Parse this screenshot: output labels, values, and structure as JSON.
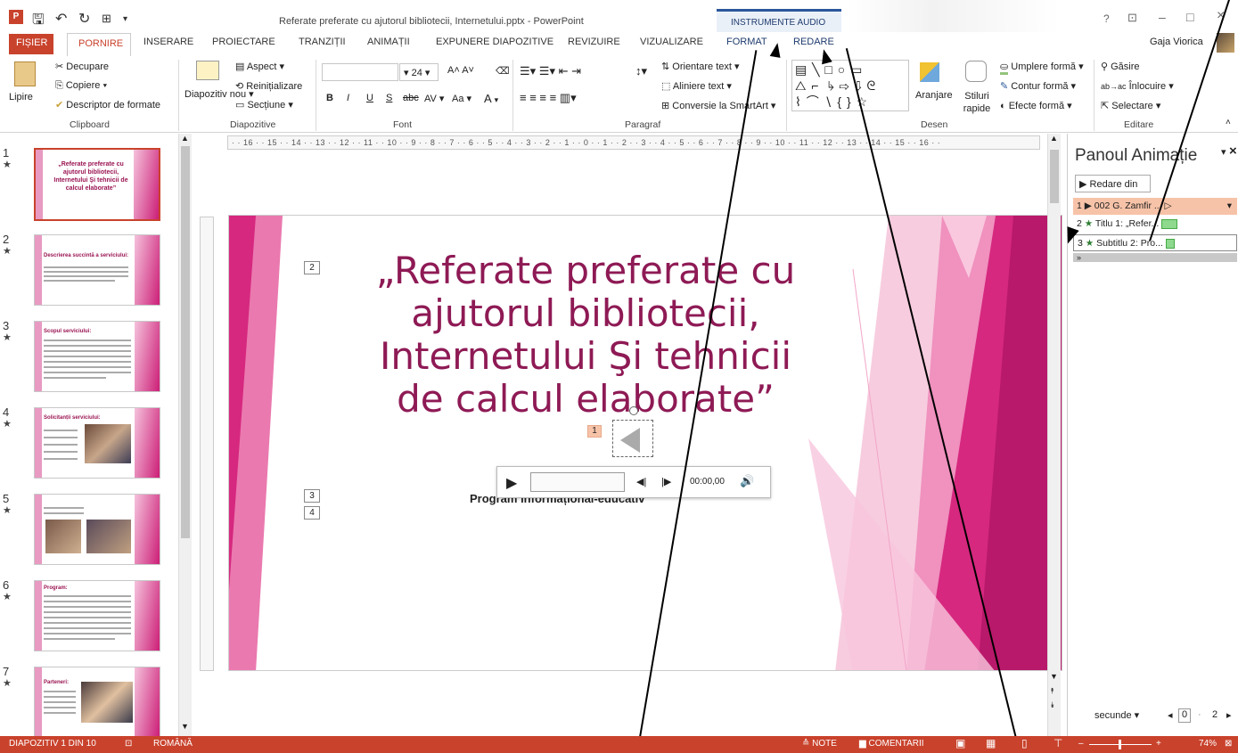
{
  "window": {
    "title": "Referate preferate cu ajutorul bibliotecii, Internetului.pptx - PowerPoint",
    "help": "?",
    "restore_ribbon": "⊡",
    "minimize": "–",
    "maximize": "□",
    "close": "×"
  },
  "context_tab": {
    "label": "INSTRUMENTE AUDIO"
  },
  "tabs": [
    "FIȘIER",
    "PORNIRE",
    "INSERARE",
    "PROIECTARE",
    "TRANZIȚII",
    "ANIMAȚII",
    "EXPUNERE DIAPOZITIVE",
    "REVIZUIRE",
    "VIZUALIZARE",
    "FORMAT",
    "REDARE"
  ],
  "user": {
    "name": "Gaja Viorica"
  },
  "ribbon": {
    "clipboard": {
      "paste": "Lipire",
      "cut": "Decupare",
      "copy": "Copiere",
      "painter": "Descriptor de formate",
      "group": "Clipboard"
    },
    "slides": {
      "new": "Diapozitiv nou",
      "layout": "Aspect",
      "reset": "Reinițializare",
      "section": "Secțiune",
      "group": "Diapozitive"
    },
    "font": {
      "size": "24",
      "bold": "B",
      "italic": "I",
      "underline": "U",
      "strike": "S",
      "aa": "Aa",
      "group": "Font"
    },
    "paragraph": {
      "dir": "Orientare text",
      "align": "Aliniere text",
      "smartart": "Conversie la SmartArt",
      "group": "Paragraf"
    },
    "drawing": {
      "arrange": "Aranjare",
      "styles": "Stiluri rapide",
      "fill": "Umplere formă",
      "outline": "Contur formă",
      "effects": "Efecte formă",
      "group": "Desen"
    },
    "editing": {
      "find": "Găsire",
      "replace": "Înlocuire",
      "select": "Selectare",
      "group": "Editare"
    }
  },
  "ruler": {
    "h": "· · 16 · · 15 · · 14 · · 13 · · 12 · · 11 · · 10 · · 9 · · 8 · · 7 · · 6 · · 5 · · 4 · · 3 · · 2 · · 1 · · 0 · · 1 · · 2 · · 3 · · 4 · · 5 · · 6 · · 7 · · 8 · · 9 · · 10 · · 11 · · 12 · · 13 · · 14 · · 15 · · 16 · ·"
  },
  "thumbs": [
    {
      "num": "1",
      "title": "„Referate preferate cu ajutorul bibliotecii, Internetului Şi tehnicii de calcul elaborate”"
    },
    {
      "num": "2",
      "title": "Descrierea succintă a serviciului:"
    },
    {
      "num": "3",
      "title": "Scopul serviciului:"
    },
    {
      "num": "4",
      "title": "Solicitanții serviciului:"
    },
    {
      "num": "5",
      "title": ""
    },
    {
      "num": "6",
      "title": "Program:"
    },
    {
      "num": "7",
      "title": "Parteneri:"
    }
  ],
  "slide": {
    "title_l1": "„Referate preferate cu",
    "title_l2": "ajutorul bibliotecii,",
    "title_l3": "Internetului Şi tehnicii",
    "title_l4": "de calcul elaborate”",
    "subtitle": "Program informațional-educativ",
    "tag1": "1",
    "tag2": "2",
    "tag3": "3",
    "tag4": "4",
    "audio_time": "00:00,00"
  },
  "anim_pane": {
    "title": "Panoul Animație",
    "play_from": "Redare din",
    "items": [
      {
        "num": "1",
        "label": "002 G. Zamfir ..."
      },
      {
        "num": "2",
        "label": "Titlu 1: „Refer..."
      },
      {
        "num": "3",
        "label": "Subtitlu 2: Pro..."
      }
    ],
    "seconds": "secunde",
    "timeline_a": "0",
    "timeline_b": "2"
  },
  "status": {
    "slide": "DIAPOZITIV 1 DIN 10",
    "lang": "ROMÂNĂ",
    "notes": "NOTE",
    "comments": "COMENTARII",
    "zoom": "74%"
  },
  "colors": {
    "accent": "#c9422c",
    "title": "#8e1a55",
    "pink": "#d6287f"
  }
}
